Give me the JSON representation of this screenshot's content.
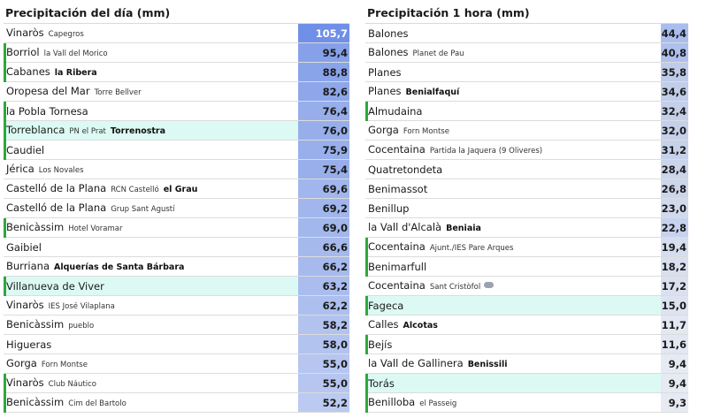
{
  "left": {
    "title": "Precipitación del día (mm)",
    "rows": [
      {
        "town": "Vinaròs",
        "sub": "Capegros",
        "sub_bold": "",
        "value": "105,7",
        "color": "#6f8fe8",
        "accent": false,
        "highlight": false,
        "inv": true
      },
      {
        "town": "Borriol",
        "sub": "la Vall del Morico",
        "sub_bold": "",
        "value": "95,4",
        "color": "#86a1ea",
        "accent": true,
        "highlight": false
      },
      {
        "town": "Cabanes",
        "sub": "",
        "sub_bold": "la Ribera",
        "value": "88,8",
        "color": "#8aa4ea",
        "accent": true,
        "highlight": false
      },
      {
        "town": "Oropesa del Mar",
        "sub": "Torre Bellver",
        "sub_bold": "",
        "value": "82,6",
        "color": "#8ea7ea",
        "accent": false,
        "highlight": false
      },
      {
        "town": "la Pobla Tornesa",
        "sub": "",
        "sub_bold": "",
        "value": "76,4",
        "color": "#97aeeb",
        "accent": true,
        "highlight": false
      },
      {
        "town": "Torreblanca",
        "sub": "PN el Prat",
        "sub_bold": "Torrenostra",
        "value": "76,0",
        "color": "#97aeeb",
        "accent": true,
        "highlight": true
      },
      {
        "town": "Caudiel",
        "sub": "",
        "sub_bold": "",
        "value": "75,9",
        "color": "#98afeb",
        "accent": true,
        "highlight": false
      },
      {
        "town": "Jérica",
        "sub": "Los Novales",
        "sub_bold": "",
        "value": "75,4",
        "color": "#98afeb",
        "accent": false,
        "highlight": false
      },
      {
        "town": "Castelló de la Plana",
        "sub": "RCN Castelló",
        "sub_bold": "el Grau",
        "value": "69,6",
        "color": "#a1b6ec",
        "accent": false,
        "highlight": false
      },
      {
        "town": "Castelló de la Plana",
        "sub": "Grup Sant Agustí",
        "sub_bold": "",
        "value": "69,2",
        "color": "#a1b6ec",
        "accent": false,
        "highlight": false
      },
      {
        "town": "Benicàssim",
        "sub": "Hotel Voramar",
        "sub_bold": "",
        "value": "69,0",
        "color": "#a2b7ec",
        "accent": true,
        "highlight": false
      },
      {
        "town": "Gaibiel",
        "sub": "",
        "sub_bold": "",
        "value": "66,6",
        "color": "#a5b9ed",
        "accent": false,
        "highlight": false
      },
      {
        "town": "Burriana",
        "sub": "",
        "sub_bold": "Alquerías de Santa Bárbara",
        "value": "66,2",
        "color": "#a6baed",
        "accent": false,
        "highlight": false
      },
      {
        "town": "Villanueva de Viver",
        "sub": "",
        "sub_bold": "",
        "value": "63,2",
        "color": "#aabdee",
        "accent": true,
        "highlight": true
      },
      {
        "town": "Vinaròs",
        "sub": "IES José Vilaplana",
        "sub_bold": "",
        "value": "62,2",
        "color": "#acbfee",
        "accent": false,
        "highlight": false
      },
      {
        "town": "Benicàssim",
        "sub": "pueblo",
        "sub_bold": "",
        "value": "58,2",
        "color": "#b2c3ef",
        "accent": false,
        "highlight": false
      },
      {
        "town": "Higueras",
        "sub": "",
        "sub_bold": "",
        "value": "58,0",
        "color": "#b2c3ef",
        "accent": false,
        "highlight": false
      },
      {
        "town": "Gorga",
        "sub": "Forn Montse",
        "sub_bold": "",
        "value": "55,0",
        "color": "#b6c6f0",
        "accent": false,
        "highlight": false
      },
      {
        "town": "Vinaròs",
        "sub": "Club Náutico",
        "sub_bold": "",
        "value": "55,0",
        "color": "#b6c6f0",
        "accent": true,
        "highlight": false
      },
      {
        "town": "Benicàssim",
        "sub": "Cim del Bartolo",
        "sub_bold": "",
        "value": "52,2",
        "color": "#bacaf0",
        "accent": true,
        "highlight": false
      }
    ]
  },
  "right": {
    "title": "Precipitación 1 hora (mm)",
    "rows": [
      {
        "town": "Balones",
        "sub": "",
        "sub_bold": "",
        "value": "44,4",
        "color": "#a9bdee",
        "accent": false,
        "highlight": false
      },
      {
        "town": "Balones",
        "sub": "Planet de Pau",
        "sub_bold": "",
        "value": "40,8",
        "color": "#aec0ee",
        "accent": false,
        "highlight": false
      },
      {
        "town": "Planes",
        "sub": "",
        "sub_bold": "",
        "value": "35,8",
        "color": "#bfcbe9",
        "accent": false,
        "highlight": false
      },
      {
        "town": "Planes",
        "sub": "",
        "sub_bold": "Benialfaquí",
        "value": "34,6",
        "color": "#c1cde9",
        "accent": false,
        "highlight": false
      },
      {
        "town": "Almudaina",
        "sub": "",
        "sub_bold": "",
        "value": "32,4",
        "color": "#c4d0ea",
        "accent": true,
        "highlight": false
      },
      {
        "town": "Gorga",
        "sub": "Forn Montse",
        "sub_bold": "",
        "value": "32,0",
        "color": "#c5d0ea",
        "accent": false,
        "highlight": false
      },
      {
        "town": "Cocentaina",
        "sub": "Partida la Jaquera (9 Oliveres)",
        "sub_bold": "",
        "value": "31,2",
        "color": "#c6d1ea",
        "accent": false,
        "highlight": false
      },
      {
        "town": "Quatretondeta",
        "sub": "",
        "sub_bold": "",
        "value": "28,4",
        "color": "#cad4eb",
        "accent": false,
        "highlight": false
      },
      {
        "town": "Benimassot",
        "sub": "",
        "sub_bold": "",
        "value": "26,8",
        "color": "#ccd6eb",
        "accent": false,
        "highlight": false
      },
      {
        "town": "Benillup",
        "sub": "",
        "sub_bold": "",
        "value": "23,0",
        "color": "#d1d9ec",
        "accent": false,
        "highlight": false
      },
      {
        "town": "la Vall d'Alcalà",
        "sub": "",
        "sub_bold": "Beniaia",
        "value": "22,8",
        "color": "#c7d2ef",
        "accent": false,
        "highlight": false
      },
      {
        "town": "Cocentaina",
        "sub": "Ajunt./IES Pare Arques",
        "sub_bold": "",
        "value": "19,4",
        "color": "#d6ddee",
        "accent": true,
        "highlight": false
      },
      {
        "town": "Benimarfull",
        "sub": "",
        "sub_bold": "",
        "value": "18,2",
        "color": "#d8dfee",
        "accent": true,
        "highlight": false
      },
      {
        "town": "Cocentaina",
        "sub": "Sant Cristòfol",
        "sub_bold": "",
        "value": "17,2",
        "color": "#dae0ef",
        "accent": false,
        "highlight": false,
        "cloud": true
      },
      {
        "town": "Fageca",
        "sub": "",
        "sub_bold": "",
        "value": "15,0",
        "color": "#dde3f0",
        "accent": true,
        "highlight": true
      },
      {
        "town": "Calles",
        "sub": "",
        "sub_bold": "Alcotas",
        "value": "11,7",
        "color": "#e2e7f2",
        "accent": false,
        "highlight": false
      },
      {
        "town": "Bejís",
        "sub": "",
        "sub_bold": "",
        "value": "11,6",
        "color": "#e2e7f2",
        "accent": true,
        "highlight": false
      },
      {
        "town": "la Vall de Gallinera",
        "sub": "",
        "sub_bold": "Benissili",
        "value": "9,4",
        "color": "#e6eaf3",
        "accent": false,
        "highlight": false
      },
      {
        "town": "Torás",
        "sub": "",
        "sub_bold": "",
        "value": "9,4",
        "color": "#e6eaf3",
        "accent": true,
        "highlight": true
      },
      {
        "town": "Benilloba",
        "sub": "el Passeig",
        "sub_bold": "",
        "value": "9,3",
        "color": "#e6eaf3",
        "accent": true,
        "highlight": false
      }
    ]
  }
}
